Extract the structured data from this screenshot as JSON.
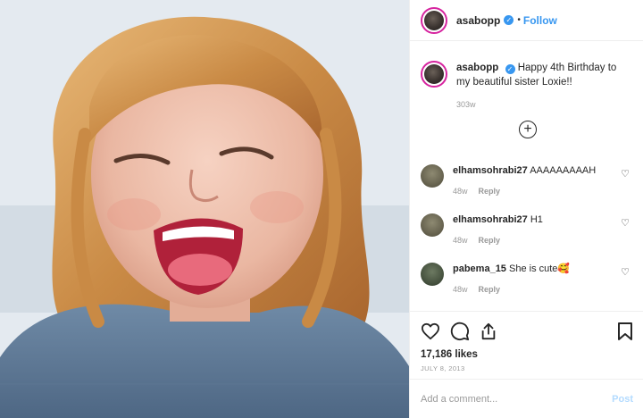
{
  "post": {
    "username": "asabopp",
    "follow_label": "Follow",
    "separator": "•",
    "caption_text": "Happy 4th Birthday to my beautiful sister Loxie!!",
    "caption_time": "303w"
  },
  "comments": [
    {
      "username": "elhamsohrabi27",
      "text": "AAAAAAAAAH",
      "time": "48w",
      "reply": "Reply",
      "avatar_color": "#6f6a58"
    },
    {
      "username": "elhamsohrabi27",
      "text": "H1",
      "time": "48w",
      "reply": "Reply",
      "avatar_color": "#6f6a58"
    },
    {
      "username": "pabema_15",
      "text": "She is cute🥰",
      "time": "48w",
      "reply": "Reply",
      "avatar_color": "#4f5a48"
    }
  ],
  "load_more_symbol": "+",
  "likes_label": "17,186 likes",
  "date_label": "JULY 8, 2013",
  "add_comment": {
    "placeholder": "Add a comment...",
    "post_label": "Post"
  },
  "colors": {
    "accent": "#3897f0",
    "muted": "#999999",
    "post_disabled": "#b3dbff"
  },
  "icons": [
    "verified-badge-icon",
    "heart-icon",
    "comment-icon",
    "share-icon",
    "bookmark-icon",
    "plus-circle-icon"
  ]
}
